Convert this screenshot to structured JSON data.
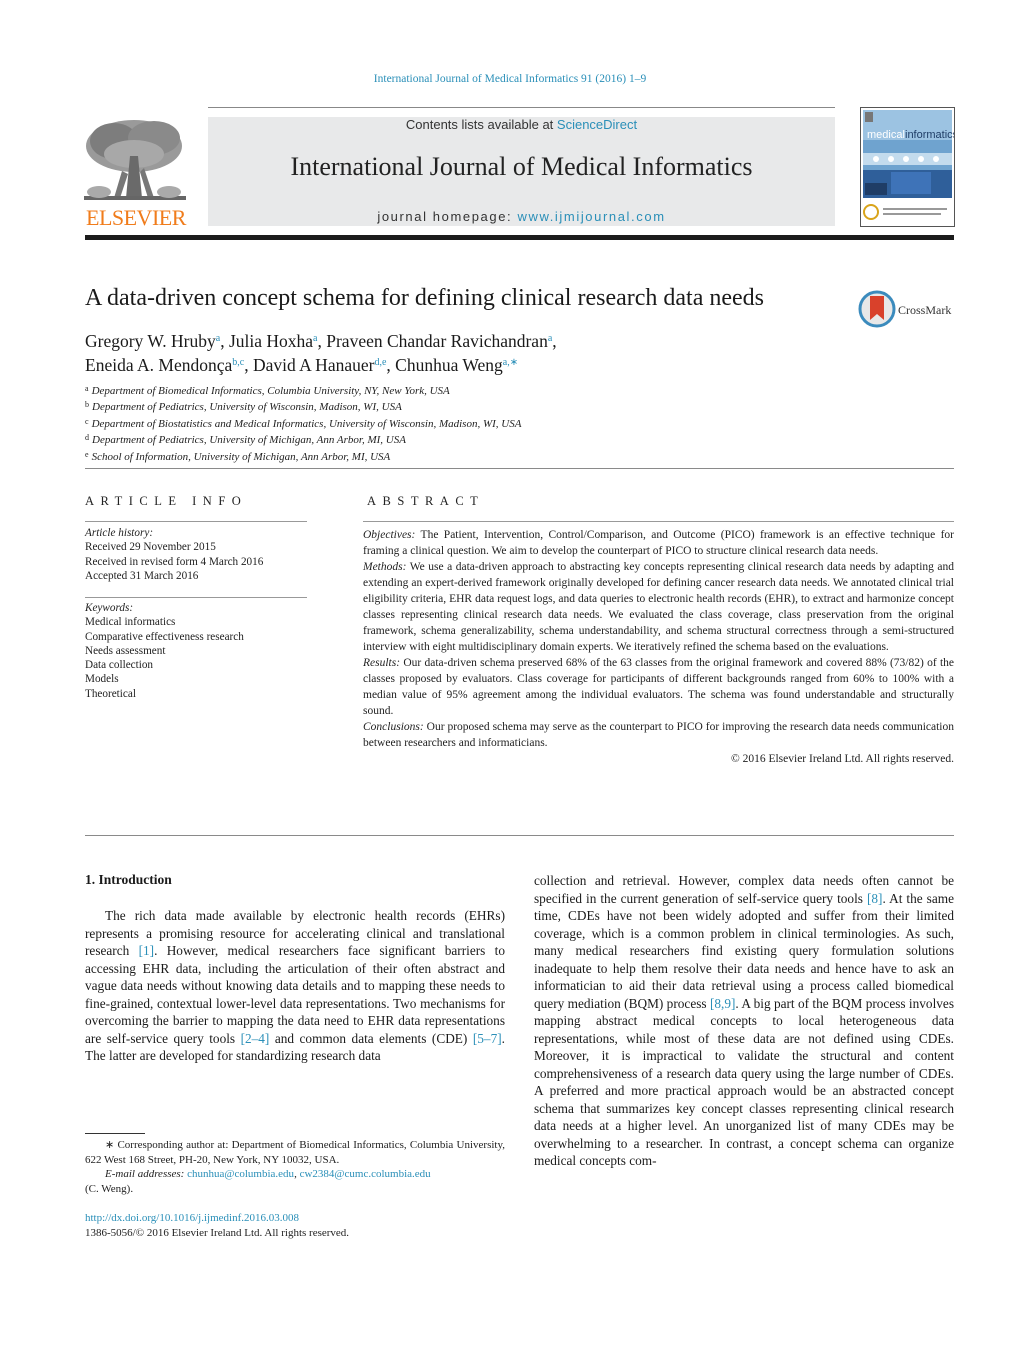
{
  "header": {
    "running_head": "International Journal of Medical Informatics 91 (2016) 1–9",
    "contents_prefix": "Contents lists available at ",
    "contents_link": "ScienceDirect",
    "journal_title": "International Journal of Medical Informatics",
    "homepage_prefix": "journal homepage: ",
    "homepage_link": "www.ijmijournal.com",
    "publisher_logo": "ELSEVIER",
    "cover_word_light": "medical",
    "cover_word_dark": "informatics"
  },
  "article": {
    "title": "A data-driven concept schema for defining clinical research data needs",
    "crossmark_label": "CrossMark",
    "authors_line1": [
      {
        "name": "Gregory W. Hruby",
        "sup": "a",
        "sep": ", "
      },
      {
        "name": "Julia Hoxha",
        "sup": "a",
        "sep": ", "
      },
      {
        "name": "Praveen Chandar Ravichandran",
        "sup": "a",
        "sep": ","
      }
    ],
    "authors_line2": [
      {
        "name": "Eneida A. Mendonça",
        "sup": "b,c",
        "sep": ", "
      },
      {
        "name": "David A Hanauer",
        "sup": "d,e",
        "sep": ", "
      },
      {
        "name": "Chunhua Weng",
        "sup": "a,∗",
        "sep": ""
      }
    ],
    "affiliations": [
      {
        "key": "a",
        "text": "Department of Biomedical Informatics, Columbia University, NY, New York, USA"
      },
      {
        "key": "b",
        "text": "Department of Pediatrics, University of Wisconsin, Madison, WI, USA"
      },
      {
        "key": "c",
        "text": "Department of Biostatistics and Medical Informatics, University of Wisconsin, Madison, WI, USA"
      },
      {
        "key": "d",
        "text": "Department of Pediatrics, University of Michigan, Ann Arbor, MI, USA"
      },
      {
        "key": "e",
        "text": "School of Information, University of Michigan, Ann Arbor, MI, USA"
      }
    ]
  },
  "article_info": {
    "heading": "ARTICLE INFO",
    "history_label": "Article history:",
    "history": [
      "Received 29 November 2015",
      "Received in revised form 4 March 2016",
      "Accepted 31 March 2016"
    ],
    "keywords_label": "Keywords:",
    "keywords": [
      "Medical informatics",
      "Comparative effectiveness research",
      "Needs assessment",
      "Data collection",
      "Models",
      "Theoretical"
    ]
  },
  "abstract": {
    "heading": "ABSTRACT",
    "objectives_label": "Objectives:",
    "objectives": " The Patient, Intervention, Control/Comparison, and Outcome (PICO) framework is an effective technique for framing a clinical question. We aim to develop the counterpart of PICO to structure clinical research data needs.",
    "methods_label": "Methods:",
    "methods": " We use a data-driven approach to abstracting key concepts representing clinical research data needs by adapting and extending an expert-derived framework originally developed for defining cancer research data needs. We annotated clinical trial eligibility criteria, EHR data request logs, and data queries to electronic health records (EHR), to extract and harmonize concept classes representing clinical research data needs. We evaluated the class coverage, class preservation from the original framework, schema generalizability, schema understandability, and schema structural correctness through a semi-structured interview with eight multidisciplinary domain experts. We iteratively refined the schema based on the evaluations.",
    "results_label": "Results:",
    "results": " Our data-driven schema preserved 68% of the 63 classes from the original framework and covered 88% (73/82) of the classes proposed by evaluators. Class coverage for participants of different backgrounds ranged from 60% to 100% with a median value of 95% agreement among the individual evaluators. The schema was found understandable and structurally sound.",
    "conclusions_label": "Conclusions:",
    "conclusions": " Our proposed schema may serve as the counterpart to PICO for improving the research data needs communication between researchers and informaticians.",
    "copyright": "© 2016 Elsevier Ireland Ltd. All rights reserved."
  },
  "body": {
    "section_heading": "1.  Introduction",
    "col1": {
      "t1": "The rich data made available by electronic health records (EHRs) represents a promising resource for accelerating clinical and translational research ",
      "r1": "[1]",
      "t2": ". However, medical researchers face significant barriers to accessing EHR data, including the articulation of their often abstract and vague data needs without knowing data details and to mapping these needs to fine-grained, contextual lower-level data representations. Two mechanisms for overcoming the barrier to mapping the data need to EHR data representations are self-service query tools ",
      "r2": "[2–4]",
      "t3": " and common data elements (CDE) ",
      "r3": "[5–7]",
      "t4": ". The latter are developed for standardizing research data"
    },
    "col2": {
      "t1": "collection and retrieval. However, complex data needs often cannot be specified in the current generation of self-service query tools ",
      "r1": "[8]",
      "t2": ". At the same time, CDEs have not been widely adopted and suffer from their limited coverage, which is a common problem in clinical terminologies. As such, many medical researchers find existing query formulation solutions inadequate to help them resolve their data needs and hence have to ask an informatician to aid their data retrieval using a process called biomedical query mediation (BQM) process ",
      "r2": "[8,9]",
      "t3": ". A big part of the BQM process involves mapping abstract medical concepts to local heterogeneous data representations, while most of these data are not defined using CDEs. Moreover, it is impractical to validate the structural and content comprehensiveness of a research data query using the large number of CDEs. A preferred and more practical approach would be an abstracted concept schema that summarizes key concept classes representing clinical research data needs at a higher level. An unorganized list of many CDEs may be overwhelming to a researcher. In contrast, a concept schema can organize medical concepts com-"
    }
  },
  "footnotes": {
    "corresponding": "∗  Corresponding author at: Department of Biomedical Informatics, Columbia University, 622 West 168 Street, PH-20, New York, NY 10032, USA.",
    "email_label": "E-mail addresses:",
    "email1": "chunhua@columbia.edu",
    "email2": "cw2384@cumc.columbia.edu",
    "email_owner": "(C. Weng).",
    "doi": "http://dx.doi.org/10.1016/j.ijmedinf.2016.03.008",
    "issn": "1386-5056/© 2016 Elsevier Ireland Ltd. All rights reserved."
  },
  "colors": {
    "link": "#2a8fb8",
    "elsevier_orange": "#f07c1b",
    "masthead_bg": "#e8e9ea"
  }
}
